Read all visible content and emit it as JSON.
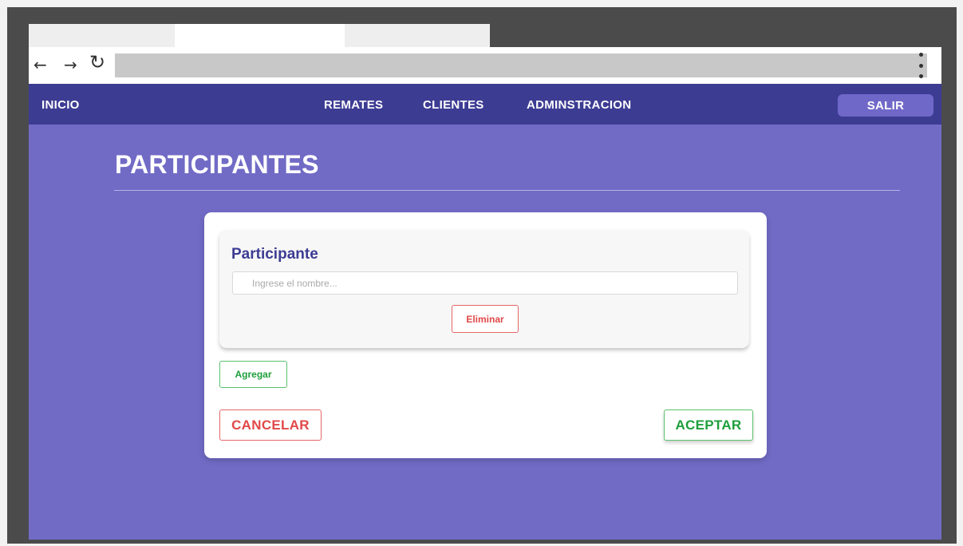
{
  "browser": {
    "back_icon": "arrow-left-icon",
    "forward_icon": "arrow-right-icon",
    "reload_icon": "reload-icon",
    "menu_icon": "kebab-menu-icon",
    "back_glyph": "←",
    "forward_glyph": "→",
    "reload_glyph": "↻"
  },
  "navbar": {
    "home": "INICIO",
    "links": [
      "REMATES",
      "CLIENTES",
      "ADMINSTRACION"
    ],
    "logout": "SALIR"
  },
  "page": {
    "title": "PARTICIPANTES"
  },
  "modal": {
    "card_title": "Participante",
    "name_placeholder": "Ingrese el nombre...",
    "delete_label": "Eliminar",
    "add_label": "Agregar",
    "cancel_label": "CANCELAR",
    "accept_label": "ACEPTAR"
  },
  "colors": {
    "navbar": "#3d3c93",
    "background": "#716bc6",
    "danger": "#e04848",
    "success": "#1e9e3b"
  }
}
